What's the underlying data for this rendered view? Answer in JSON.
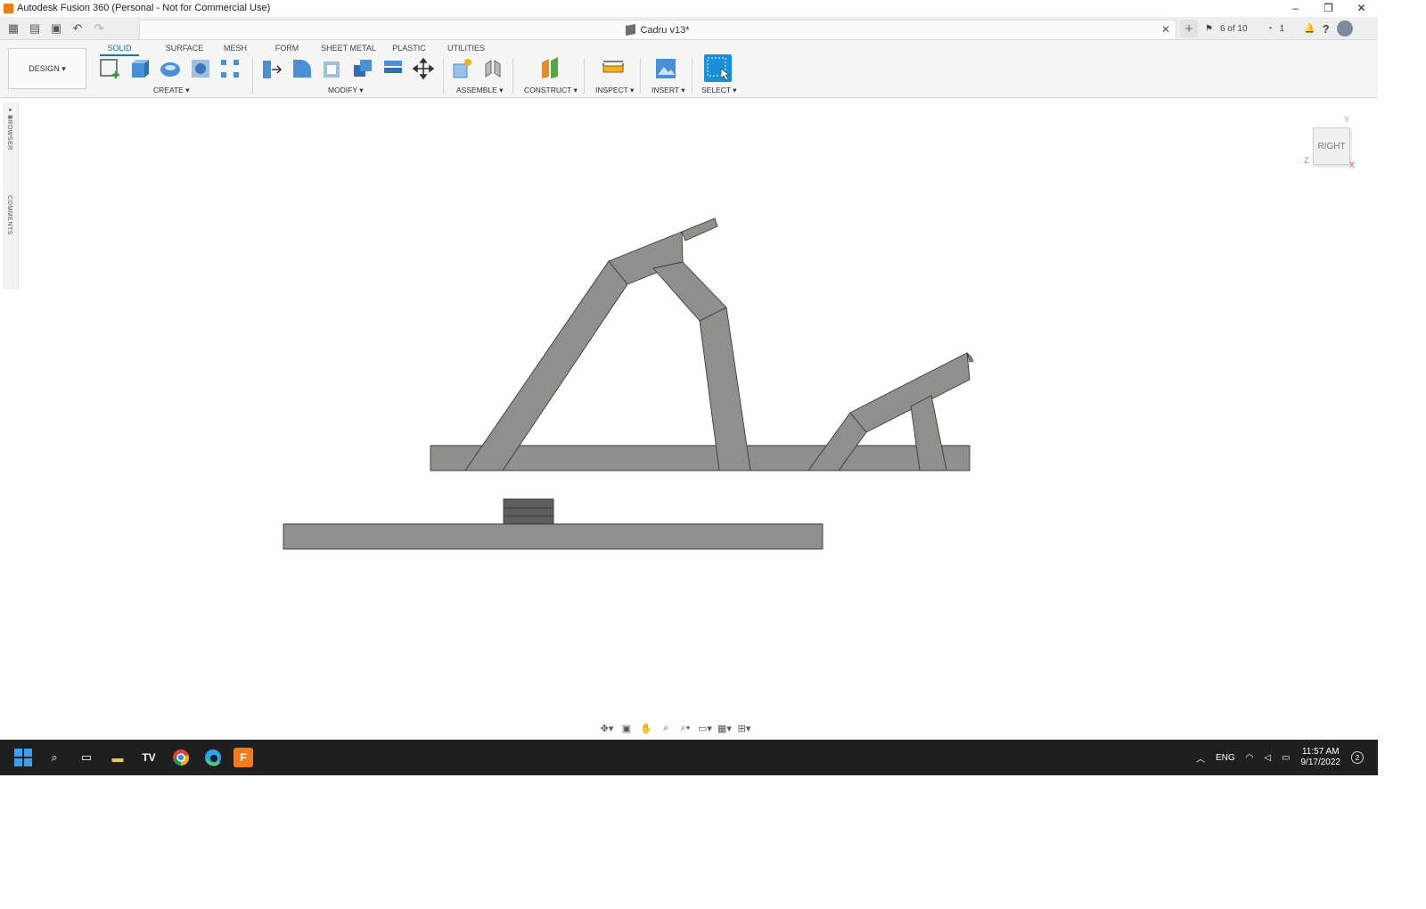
{
  "window": {
    "title": "Autodesk Fusion 360 (Personal - Not for Commercial Use)",
    "minimize_glyph": "–",
    "restore_glyph": "❐",
    "close_glyph": "✕"
  },
  "document": {
    "tab_title": "Cadru v13*",
    "close_glyph": "✕"
  },
  "quick_access": {
    "jobs_status": "6 of 10",
    "clock_count": "1",
    "add_glyph": "+"
  },
  "workspace": {
    "mode_label": "DESIGN ▾"
  },
  "ribbon": {
    "tabs": [
      "SOLID",
      "SURFACE",
      "MESH",
      "FORM",
      "SHEET METAL",
      "PLASTIC",
      "UTILITIES"
    ],
    "groups": {
      "create": "CREATE ▾",
      "modify": "MODIFY ▾",
      "assemble": "ASSEMBLE ▾",
      "construct": "CONSTRUCT ▾",
      "inspect": "INSPECT ▾",
      "insert": "INSERT ▾",
      "select": "SELECT ▾"
    }
  },
  "side_panel": {
    "browser_label": "BROWSER",
    "comments_label": "COMMENTS"
  },
  "viewcube": {
    "face_label": "RIGHT",
    "axis_y": "Y",
    "axis_z": "Z",
    "axis_x": "X"
  },
  "taskbar": {
    "language": "ENG",
    "time": "11:57 AM",
    "date": "9/17/2022",
    "notifications": "2"
  },
  "colors": {
    "accent": "#1a6fb5",
    "frame_fill": "#8f8f8b",
    "frame_stroke": "#3a3a3a",
    "fusion_orange": "#f27b1a",
    "taskbar": "#1f1f1f"
  }
}
